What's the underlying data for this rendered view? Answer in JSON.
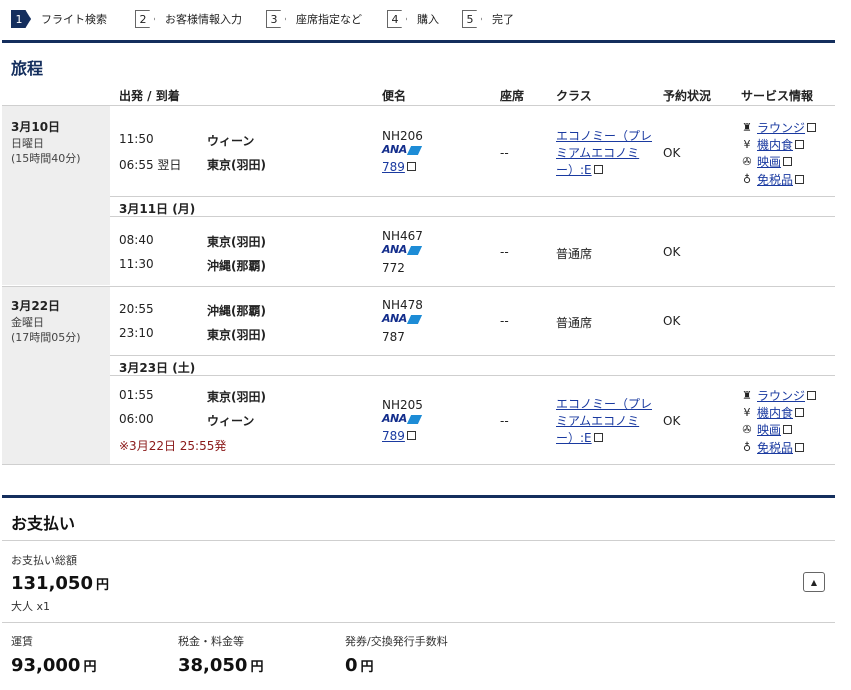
{
  "steps": [
    {
      "num": "1",
      "label": "フライト検索"
    },
    {
      "num": "2",
      "label": "お客様情報入力"
    },
    {
      "num": "3",
      "label": "座席指定など"
    },
    {
      "num": "4",
      "label": "購入"
    },
    {
      "num": "5",
      "label": "完了"
    }
  ],
  "itinerary": {
    "title": "旅程",
    "headers": {
      "route": "出発 / 到着",
      "flight": "便名",
      "seat": "座席",
      "class": "クラス",
      "status": "予約状況",
      "service": "サービス情報"
    },
    "blocks": [
      {
        "date": "3月10日",
        "weekday": "日曜日",
        "duration": "(15時間40分)"
      },
      {
        "date": "3月22日",
        "weekday": "金曜日",
        "duration": "(17時間05分)"
      }
    ],
    "segments": [
      {
        "dep_time": "11:50",
        "dep_city": "ウィーン",
        "arr_time": "06:55 翌日",
        "arr_city": "東京(羽田)",
        "flight": "NH206",
        "aircraft": "789",
        "seat": "--",
        "class": "エコノミー（プレミアムエコノミー）:E",
        "status": "OK"
      },
      {
        "date_header": "3月11日 (月)",
        "dep_time": "08:40",
        "dep_city": "東京(羽田)",
        "arr_time": "11:30",
        "arr_city": "沖縄(那覇)",
        "flight": "NH467",
        "aircraft": "772",
        "seat": "--",
        "class": "普通席",
        "status": "OK"
      },
      {
        "dep_time": "20:55",
        "dep_city": "沖縄(那覇)",
        "arr_time": "23:10",
        "arr_city": "東京(羽田)",
        "flight": "NH478",
        "aircraft": "787",
        "seat": "--",
        "class": "普通席",
        "status": "OK"
      },
      {
        "date_header": "3月23日 (土)",
        "dep_time": "01:55",
        "dep_city": "東京(羽田)",
        "arr_time": "06:00",
        "arr_city": "ウィーン",
        "note": "※3月22日 25:55発",
        "flight": "NH205",
        "aircraft": "789",
        "seat": "--",
        "class": "エコノミー（プレミアムエコノミー）:E",
        "status": "OK"
      }
    ],
    "airline_logo": "ANA",
    "services": [
      "ラウンジ",
      "機内食",
      "映画",
      "免税品"
    ],
    "class_lines": [
      "エコノミー（プレ",
      "ミアムエコノミ",
      "ー）:E"
    ]
  },
  "payment": {
    "title": "お支払い",
    "total_label": "お支払い総額",
    "total_value": "131,050",
    "yen": "円",
    "passengers": "大人 x1",
    "fare_label": "運賃",
    "fare_value": "93,000",
    "tax_label": "税金・料金等",
    "tax_value": "38,050",
    "fee_label": "発券/交換発行手数料",
    "fee_value": "0"
  },
  "colors": {
    "navy": "#142e5d",
    "link": "#1a3aa0",
    "note": "#8b1a1a",
    "gray": "#eeeeee"
  }
}
